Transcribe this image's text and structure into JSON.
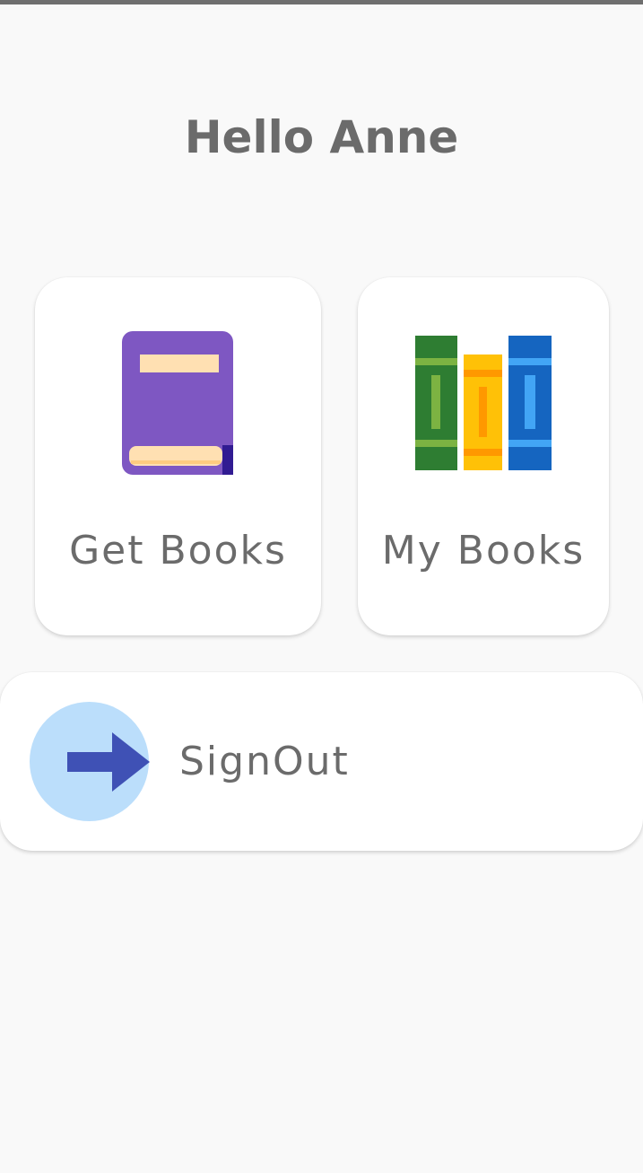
{
  "greeting": "Hello Anne",
  "cards": {
    "get_books": {
      "label": "Get Books",
      "icon": "book-icon"
    },
    "my_books": {
      "label": "My Books",
      "icon": "books-shelf-icon"
    }
  },
  "signout": {
    "label": "SignOut",
    "icon": "arrow-right-icon"
  },
  "colors": {
    "background": "#f9f9f9",
    "card": "#ffffff",
    "text": "#6b6b6b",
    "signout_avatar": "#bbdefb",
    "signout_arrow": "#3f51b5"
  }
}
